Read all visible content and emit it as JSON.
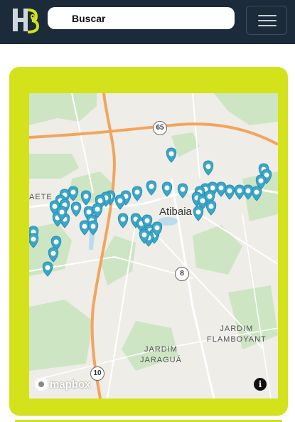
{
  "header": {
    "logo_icon": "bh-logo-icon",
    "search_placeholder": "Buscar",
    "menu_icon": "hamburger-icon",
    "background": "#1c2b3a"
  },
  "map_card": {
    "accent_color": "#d3e21a",
    "labels": {
      "city": "Atibaia",
      "aete": "AETE",
      "jardim_flamboyant": "JARDIM\nFLAMBOYANT",
      "jardim_jaragua": "JARDIM\nJARAGUÁ"
    },
    "route_shields": [
      "65",
      "8",
      "10"
    ],
    "attribution": "mapbox",
    "info_icon": "info-icon",
    "marker_icon": "map-pin-icon",
    "marker_color": "#3aa7c9"
  }
}
